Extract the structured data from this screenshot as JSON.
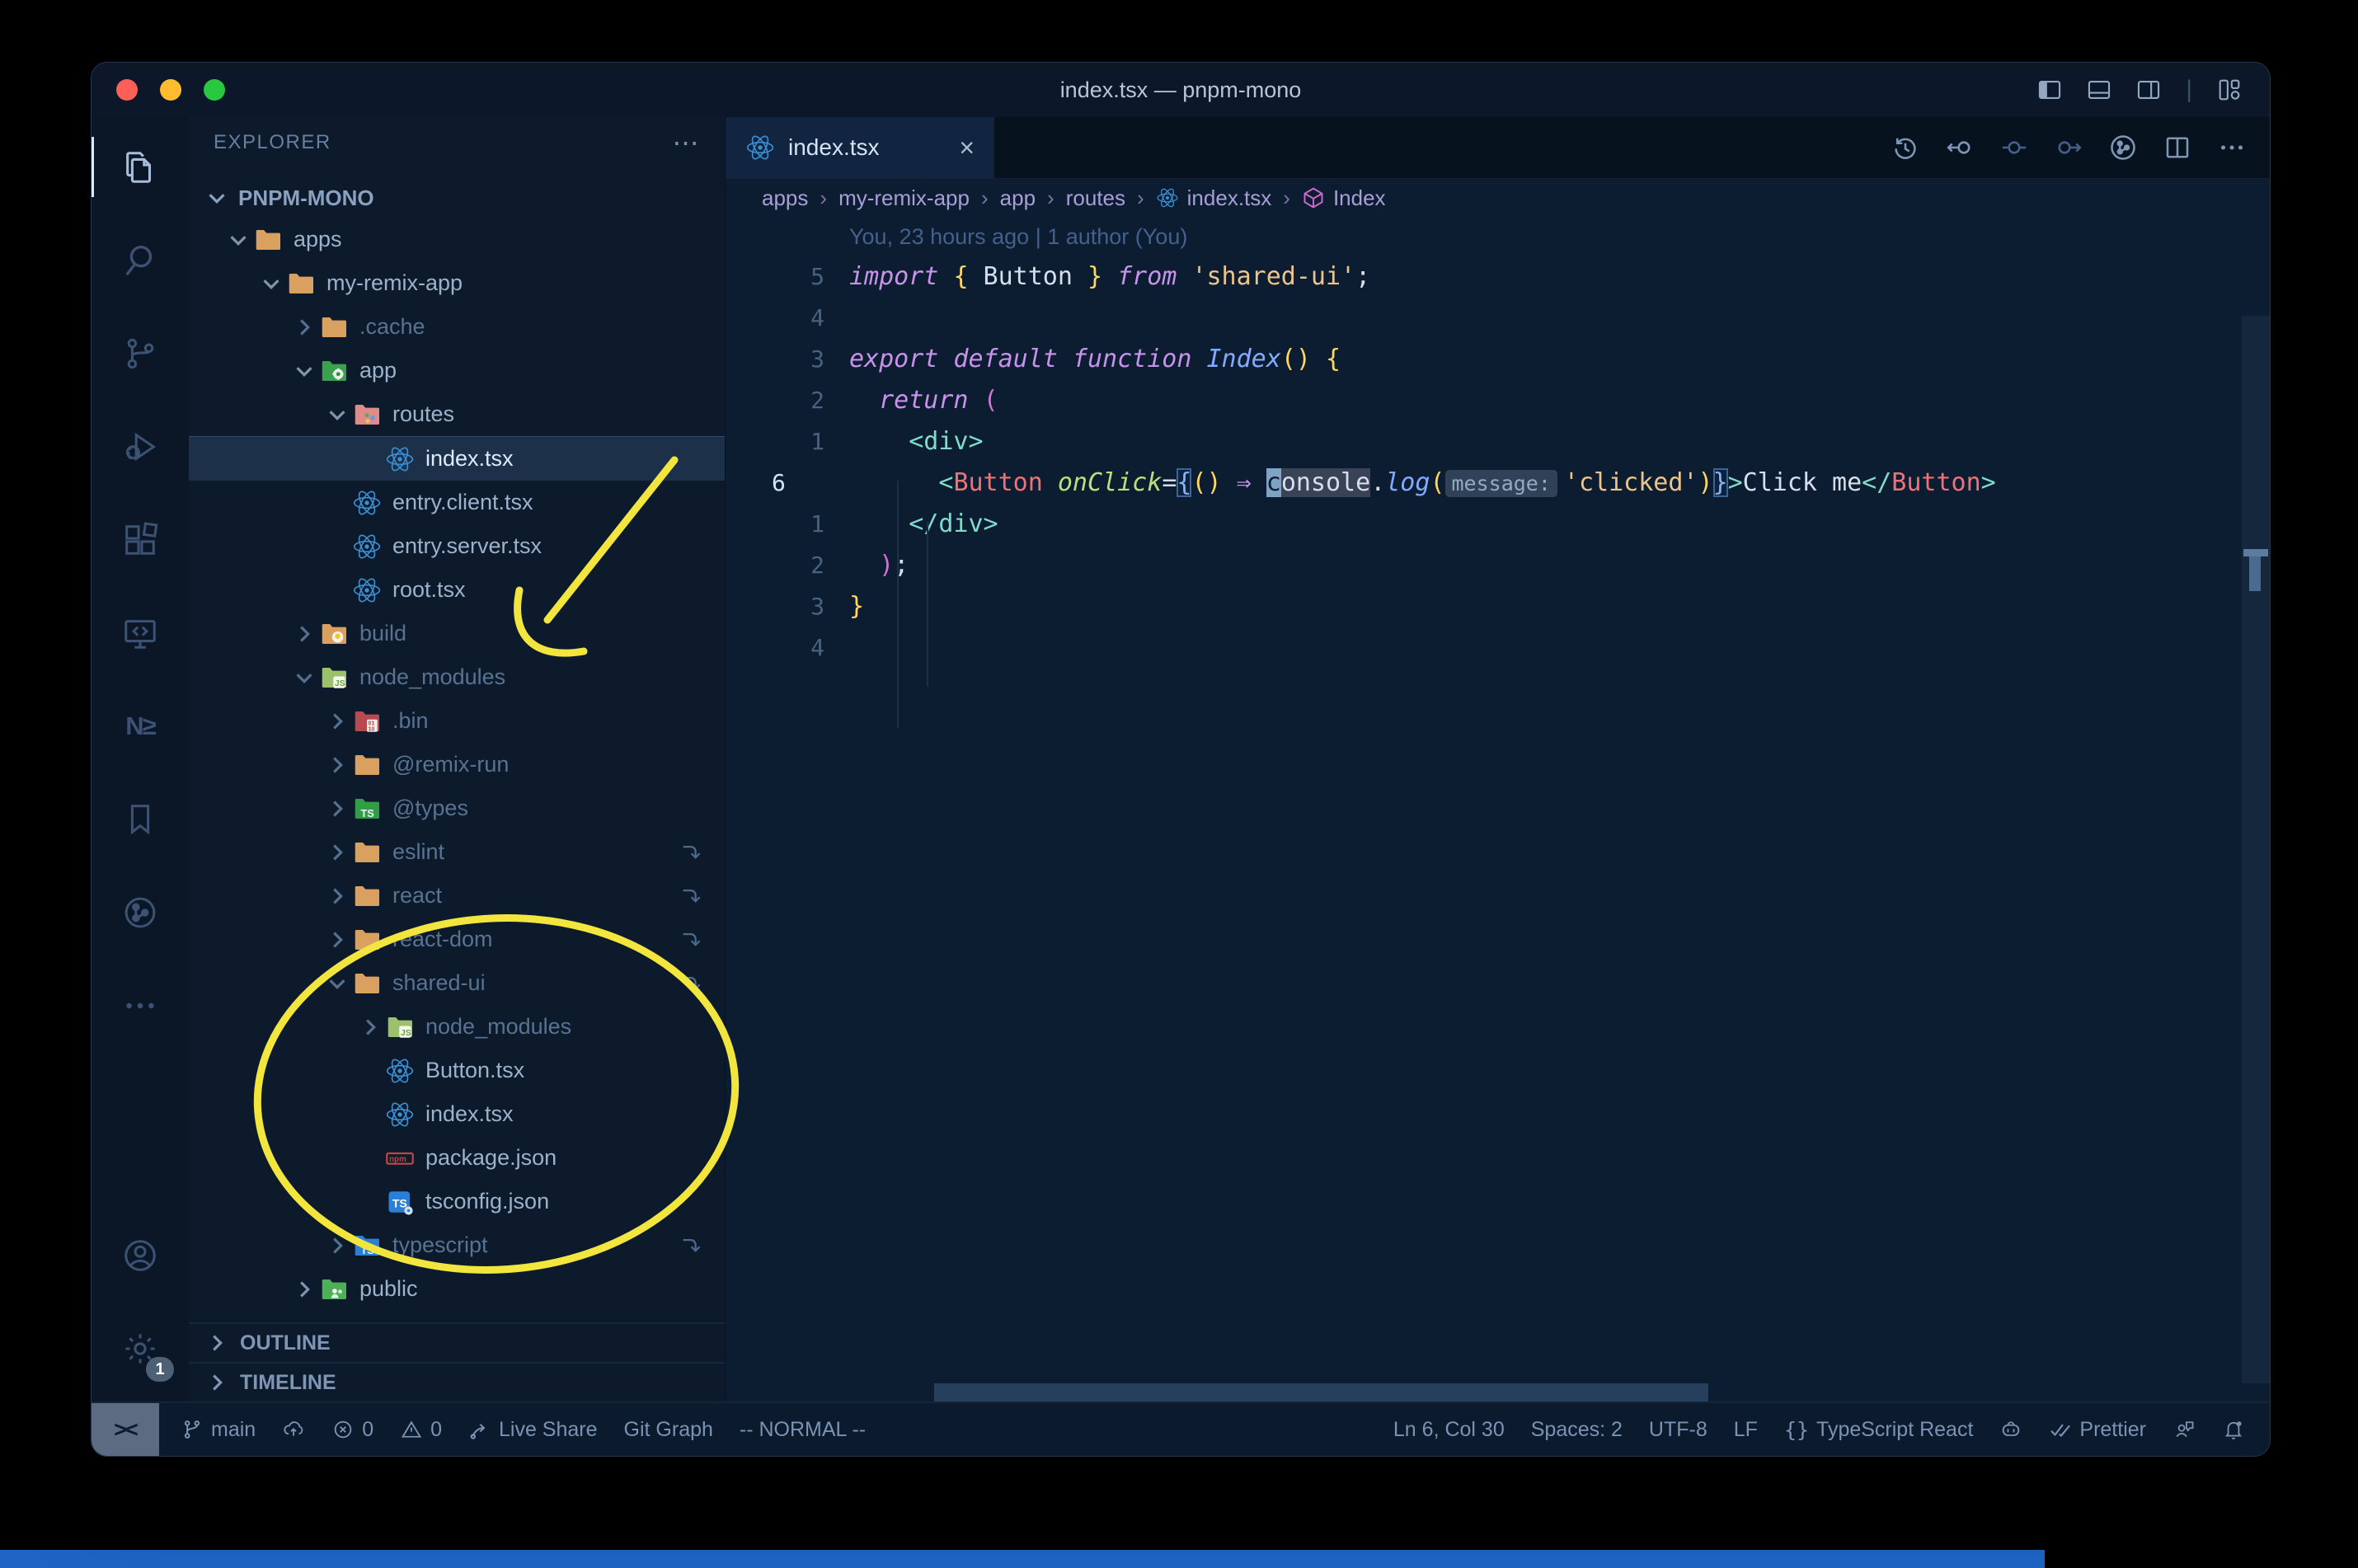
{
  "window": {
    "title": "index.tsx — pnpm-mono",
    "controls": [
      "#ff5f57",
      "#febc2e",
      "#28c840"
    ]
  },
  "titlebar": {
    "right_icons": [
      "layout-sidebar-left",
      "layout-panel",
      "layout-sidebar-right",
      "sep",
      "layout-customize"
    ]
  },
  "activity_bar": {
    "top": [
      {
        "id": "explorer",
        "active": true
      },
      {
        "id": "search"
      },
      {
        "id": "source-control"
      },
      {
        "id": "run-debug"
      },
      {
        "id": "extensions"
      },
      {
        "id": "remote-explorer"
      },
      {
        "id": "nx-console"
      },
      {
        "id": "bookmarks"
      },
      {
        "id": "git-graph"
      },
      {
        "id": "more"
      }
    ],
    "bottom": [
      {
        "id": "account"
      },
      {
        "id": "settings",
        "badge": "1"
      }
    ]
  },
  "explorer": {
    "header": "EXPLORER",
    "more": "⋯",
    "root": "PNPM-MONO",
    "tree": [
      {
        "label": "apps",
        "level": 0,
        "chevron": "down",
        "icon": "folder"
      },
      {
        "label": "my-remix-app",
        "level": 1,
        "chevron": "down",
        "icon": "folder"
      },
      {
        "label": ".cache",
        "level": 2,
        "chevron": "right",
        "icon": "folder",
        "dim": true
      },
      {
        "label": "app",
        "level": 2,
        "chevron": "down",
        "icon": "folder-app"
      },
      {
        "label": "routes",
        "level": 3,
        "chevron": "down",
        "icon": "folder-routes"
      },
      {
        "label": "index.tsx",
        "level": 4,
        "icon": "react",
        "selected": true
      },
      {
        "label": "entry.client.tsx",
        "level": 3,
        "icon": "react"
      },
      {
        "label": "entry.server.tsx",
        "level": 3,
        "icon": "react"
      },
      {
        "label": "root.tsx",
        "level": 3,
        "icon": "react"
      },
      {
        "label": "build",
        "level": 2,
        "chevron": "right",
        "icon": "folder-build",
        "dim": true
      },
      {
        "label": "node_modules",
        "level": 2,
        "chevron": "down",
        "icon": "folder-nm",
        "dim": true
      },
      {
        "label": ".bin",
        "level": 3,
        "chevron": "right",
        "icon": "folder-bin",
        "dim": true
      },
      {
        "label": "@remix-run",
        "level": 3,
        "chevron": "right",
        "icon": "folder",
        "dim": true
      },
      {
        "label": "@types",
        "level": 3,
        "chevron": "right",
        "icon": "folder-types",
        "dim": true
      },
      {
        "label": "eslint",
        "level": 3,
        "chevron": "right",
        "icon": "folder",
        "dim": true,
        "symlink": true
      },
      {
        "label": "react",
        "level": 3,
        "chevron": "right",
        "icon": "folder",
        "dim": true,
        "symlink": true
      },
      {
        "label": "react-dom",
        "level": 3,
        "chevron": "right",
        "icon": "folder",
        "dim": true,
        "symlink": true
      },
      {
        "label": "shared-ui",
        "level": 3,
        "chevron": "down",
        "icon": "folder",
        "dim": true,
        "symlink": true
      },
      {
        "label": "node_modules",
        "level": 4,
        "chevron": "right",
        "icon": "folder-nm",
        "dim": true
      },
      {
        "label": "Button.tsx",
        "level": 4,
        "icon": "react"
      },
      {
        "label": "index.tsx",
        "level": 4,
        "icon": "react"
      },
      {
        "label": "package.json",
        "level": 4,
        "icon": "npm"
      },
      {
        "label": "tsconfig.json",
        "level": 4,
        "icon": "tsconfig"
      },
      {
        "label": "typescript",
        "level": 3,
        "chevron": "right",
        "icon": "folder-ts",
        "dim": true,
        "symlink": true
      },
      {
        "label": "public",
        "level": 2,
        "chevron": "right",
        "icon": "folder-public"
      }
    ],
    "sections": [
      "OUTLINE",
      "TIMELINE"
    ]
  },
  "tab": {
    "label": "index.tsx",
    "icon": "react",
    "close": "×"
  },
  "editor_toolbar": [
    {
      "id": "timeline-history"
    },
    {
      "id": "nav-back"
    },
    {
      "id": "nav-current",
      "dim": true
    },
    {
      "id": "nav-forward",
      "dim": true
    },
    {
      "id": "git-graph-circle"
    },
    {
      "id": "split-editor"
    },
    {
      "id": "more-actions"
    }
  ],
  "breadcrumbs": {
    "separator": "›",
    "items": [
      {
        "label": "apps"
      },
      {
        "label": "my-remix-app"
      },
      {
        "label": "app"
      },
      {
        "label": "routes"
      },
      {
        "label": "index.tsx",
        "icon": "react"
      },
      {
        "label": "Index",
        "icon": "symbol-cube"
      }
    ]
  },
  "editor": {
    "blame": "You, 23 hours ago | 1 author (You)",
    "lines": [
      {
        "num": "5",
        "tokens": [
          [
            "kw",
            "import "
          ],
          [
            "gold",
            "{"
          ],
          [
            "plain",
            " Button "
          ],
          [
            "gold",
            "}"
          ],
          [
            "kw",
            " from "
          ],
          [
            "str",
            "'shared-ui'"
          ],
          [
            "plain",
            ";"
          ]
        ]
      },
      {
        "num": "4",
        "tokens": []
      },
      {
        "num": "3",
        "tokens": [
          [
            "kw",
            "export "
          ],
          [
            "kw",
            "default "
          ],
          [
            "kw",
            "function "
          ],
          [
            "fnit",
            "Index"
          ],
          [
            "gold",
            "()"
          ],
          [
            "plain",
            " "
          ],
          [
            "gold",
            "{"
          ]
        ]
      },
      {
        "num": "2",
        "tokens": [
          [
            "plain",
            "  "
          ],
          [
            "kw",
            "return "
          ],
          [
            "pink",
            "("
          ]
        ]
      },
      {
        "num": "1",
        "tokens": [
          [
            "plain",
            "    "
          ],
          [
            "tag",
            "<div>"
          ]
        ]
      },
      {
        "num": "6",
        "current": true,
        "tokens": [
          [
            "plain",
            "      "
          ],
          [
            "tag",
            "<"
          ],
          [
            "tagred",
            "Button"
          ],
          [
            "plain",
            " "
          ],
          [
            "attr",
            "onClick"
          ],
          [
            "plain",
            "="
          ],
          [
            "bm",
            "{"
          ],
          [
            "gold",
            "()"
          ],
          [
            "plain",
            " "
          ],
          [
            "arrow",
            "⇒"
          ],
          [
            "plain",
            " "
          ],
          [
            "cursor",
            "c"
          ],
          [
            "hl",
            "onsole"
          ],
          [
            "plain",
            "."
          ],
          [
            "fnit",
            "log"
          ],
          [
            "gold",
            "("
          ],
          [
            "inlay",
            "message:"
          ],
          [
            "str",
            "'clicked'"
          ],
          [
            "gold",
            ")"
          ],
          [
            "bm",
            "}"
          ],
          [
            "tag",
            ">"
          ],
          [
            "plain",
            "Click me"
          ],
          [
            "tag",
            "</"
          ],
          [
            "tagred",
            "Button"
          ],
          [
            "tag",
            ">"
          ]
        ]
      },
      {
        "num": "1",
        "tokens": [
          [
            "plain",
            "    "
          ],
          [
            "tag",
            "</div>"
          ]
        ]
      },
      {
        "num": "2",
        "tokens": [
          [
            "plain",
            "  "
          ],
          [
            "pink",
            ")"
          ],
          [
            "plain",
            ";"
          ]
        ]
      },
      {
        "num": "3",
        "tokens": [
          [
            "gold",
            "}"
          ]
        ]
      },
      {
        "num": "4",
        "tokens": []
      }
    ]
  },
  "status_bar": {
    "remote": "><",
    "left": [
      {
        "icon": "branch",
        "label": "main"
      },
      {
        "icon": "cloud-upload",
        "label": ""
      },
      {
        "icon": "error",
        "label": "0"
      },
      {
        "icon": "warning",
        "label": "0"
      },
      {
        "icon": "live-share",
        "label": "Live Share"
      },
      {
        "icon": "",
        "label": "Git Graph"
      },
      {
        "icon": "",
        "label": "-- NORMAL --"
      }
    ],
    "right": [
      {
        "icon": "",
        "label": "Ln 6, Col 30"
      },
      {
        "icon": "",
        "label": "Spaces: 2"
      },
      {
        "icon": "",
        "label": "UTF-8"
      },
      {
        "icon": "",
        "label": "LF"
      },
      {
        "icon": "braces",
        "label": "TypeScript React"
      },
      {
        "icon": "copilot",
        "label": ""
      },
      {
        "icon": "check-double",
        "label": "Prettier"
      },
      {
        "icon": "feedback",
        "label": ""
      },
      {
        "icon": "bell-dot",
        "label": ""
      }
    ]
  },
  "annotations": {
    "color": "#f2e53d"
  },
  "background_strip_color": "#1d64c4"
}
